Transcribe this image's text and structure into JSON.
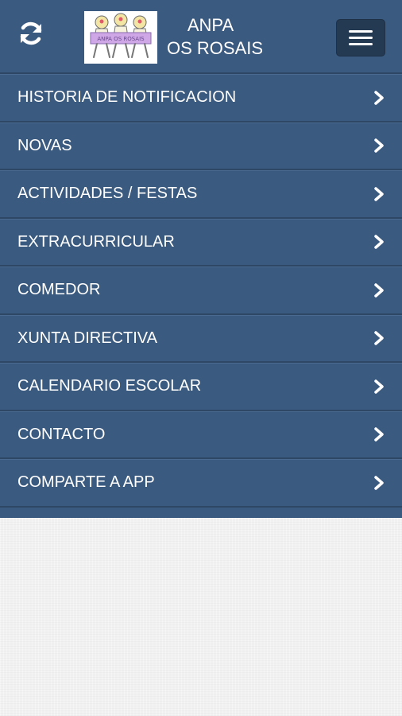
{
  "header": {
    "title_line1": "ANPA",
    "title_line2": "OS ROSAIS",
    "logo_text": "ANPA OS ROSAIS",
    "refresh_icon": "refresh-icon",
    "menu_icon": "hamburger-icon"
  },
  "menu": {
    "items": [
      {
        "label": "HISTORIA DE NOTIFICACION"
      },
      {
        "label": "NOVAS"
      },
      {
        "label": "ACTIVIDADES / FESTAS"
      },
      {
        "label": "EXTRACURRICULAR"
      },
      {
        "label": "COMEDOR"
      },
      {
        "label": "XUNTA DIRECTIVA"
      },
      {
        "label": "CALENDARIO ESCOLAR"
      },
      {
        "label": "CONTACTO"
      },
      {
        "label": "COMPARTE A APP"
      }
    ]
  },
  "colors": {
    "panel": "#3b5a7f",
    "menu_button": "#243a52",
    "background": "#f1f1f1"
  }
}
